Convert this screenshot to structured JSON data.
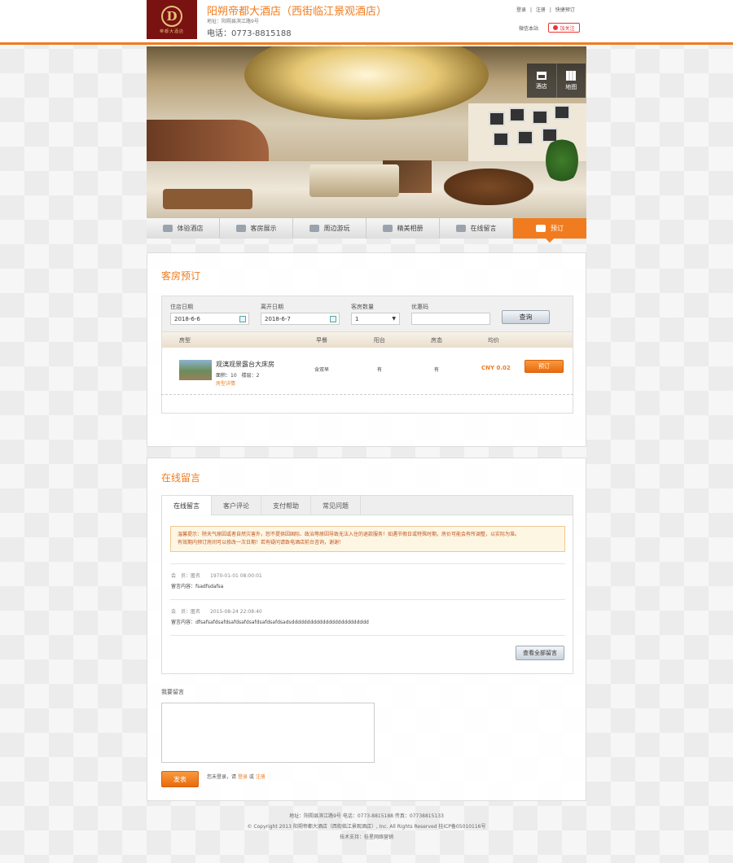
{
  "header": {
    "hotel_name": "阳朔帝都大酒店（西街临江景观酒店）",
    "address": "地址：阳朔县滨江路9号",
    "phone": "电话：0773-8815188",
    "logo_letter": "D",
    "logo_text": "帝都大酒店",
    "links": [
      "登录",
      "|",
      "注册",
      "|",
      "快捷预订"
    ],
    "mobile_link": "微信本站",
    "follow_label": "加关注"
  },
  "banner": {
    "tools": [
      {
        "label": "酒店",
        "icon": "store-icon"
      },
      {
        "label": "地图",
        "icon": "map-icon"
      }
    ]
  },
  "nav": {
    "items": [
      {
        "label": "体验酒店",
        "icon": "coffee-icon"
      },
      {
        "label": "客房展示",
        "icon": "bed-icon"
      },
      {
        "label": "周边游玩",
        "icon": "plane-icon"
      },
      {
        "label": "精美相册",
        "icon": "photo-icon"
      },
      {
        "label": "在线留言",
        "icon": "chat-icon"
      },
      {
        "label": "预订",
        "icon": "cart-icon"
      }
    ],
    "active_index": 5
  },
  "booking": {
    "title": "客房预订",
    "checkin_label": "住店日期",
    "checkin_value": "2018-6-6",
    "checkout_label": "离开日期",
    "checkout_value": "2018-6-7",
    "rooms_label": "客房数量",
    "rooms_value": "1",
    "coupon_label": "优惠码",
    "coupon_value": "",
    "search_button": "查询",
    "columns": [
      "房型",
      "早餐",
      "阳台",
      "房态",
      "均价"
    ],
    "rooms": [
      {
        "name": "观漓观景露台大床房",
        "area": "面积：10",
        "floor": "楼层：2",
        "details_link": "房型详情",
        "breakfast": "含双早",
        "balcony": "有",
        "status": "有",
        "price": "CNY 0.02",
        "book_button": "预订"
      }
    ]
  },
  "message": {
    "title": "在线留言",
    "tabs": [
      "在线留言",
      "客户评论",
      "支付帮助",
      "常见问题"
    ],
    "active_tab": 0,
    "notice_line1": "温馨提示：除天气原因或者自然灾害外，恕不提供因国际、政治等原因导致无法入住的退款服务！如遇节假日或特殊时期，房价可能会有所调整，以实际为准。",
    "notice_line2": "有效期内预订房间可以修改一次日期！若有疑问请致电酒店前台咨询，谢谢！",
    "messages": [
      {
        "meta": "会　员：匿名　　1970-01-01 08:00:01",
        "content": "留言内容：fsadfsdafsa"
      },
      {
        "meta": "会　员：匿名　　2015-08-24 22:08:40",
        "content": "留言内容：dfsafsafdsafdsafdsafdsafdsafdsafdsadsddddddddddddddddddddddddd"
      }
    ],
    "view_all_button": "查看全部留言",
    "my_message_label": "我要留言",
    "submit_button": "发表",
    "login_hint_prefix": "您未登录，请",
    "login_link": "登录",
    "login_hint_or": "或",
    "register_link": "注册"
  },
  "footer": {
    "line1": "地址：阳朔县滨江路9号 电话：0773-8815188 传真：07738815133",
    "line2": "© Copyright 2013 阳朔帝都大酒店（西街临江景观酒店）, Inc. All Rights Reserved 桂ICP备05010116号",
    "line3": "技术支持：桂星网络营销"
  }
}
